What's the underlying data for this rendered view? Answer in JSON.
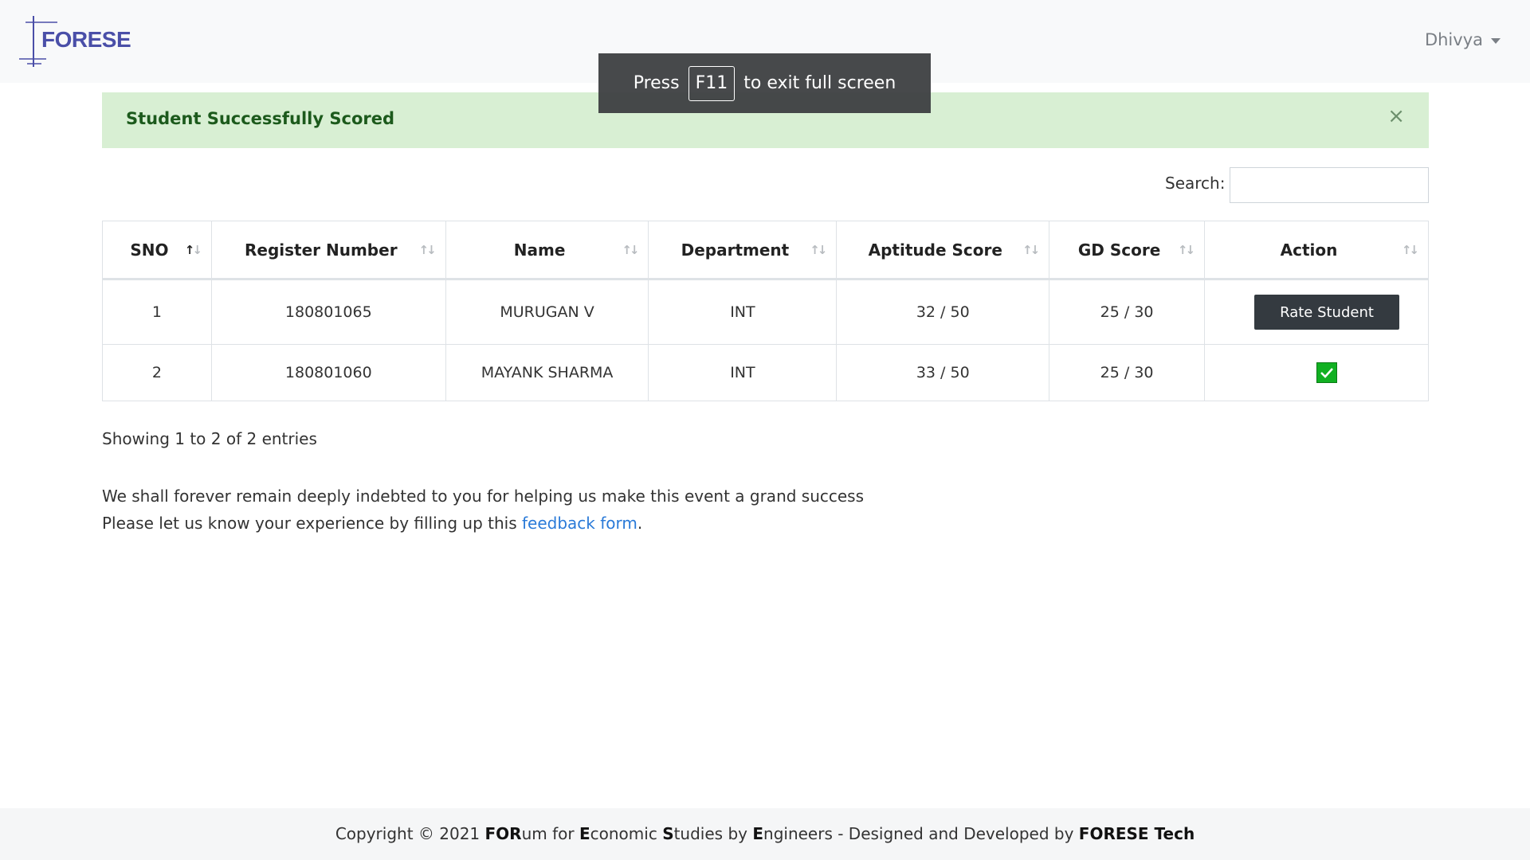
{
  "navbar": {
    "logo_text": "FORESE",
    "user_name": "Dhivya"
  },
  "toast": {
    "prefix": "Press",
    "key": "F11",
    "suffix": "to exit full screen"
  },
  "alert": {
    "message": "Student Successfully Scored",
    "close_symbol": "×"
  },
  "search": {
    "label": "Search:",
    "value": ""
  },
  "table": {
    "headers": [
      "SNO",
      "Register Number",
      "Name",
      "Department",
      "Aptitude Score",
      "GD Score",
      "Action"
    ],
    "rows": [
      {
        "sno": "1",
        "register": "180801065",
        "name": "MURUGAN V",
        "department": "INT",
        "aptitude": "32 / 50",
        "gd": "25 / 30",
        "action_label": "Rate Student"
      },
      {
        "sno": "2",
        "register": "180801060",
        "name": "MAYANK SHARMA",
        "department": "INT",
        "aptitude": "33 / 50",
        "gd": "25 / 30",
        "action_icon": "check-icon"
      }
    ]
  },
  "info": "Showing 1 to 2 of 2 entries",
  "thanks": {
    "line1": "We shall forever remain deeply indebted to you for helping us make this event a grand success",
    "line2_prefix": "Please let us know your experience by filling up this",
    "link_text": "feedback form",
    "line2_suffix": "."
  },
  "footer": {
    "copyright": "Copyright © 2021",
    "part_for_bold": "FOR",
    "part_for_rest": "um for",
    "part_e_bold": "E",
    "part_e_rest": "conomic",
    "part_s_bold": "S",
    "part_s_rest": "tudies by",
    "part_e2_bold": "E",
    "part_e2_rest": "ngineers - Designed and Developed by",
    "team": "FORESE Tech"
  },
  "colors": {
    "alert_bg": "#d8efd3",
    "button_bg": "#343a40",
    "check_green": "#11b022",
    "link": "#2a7ad8"
  }
}
